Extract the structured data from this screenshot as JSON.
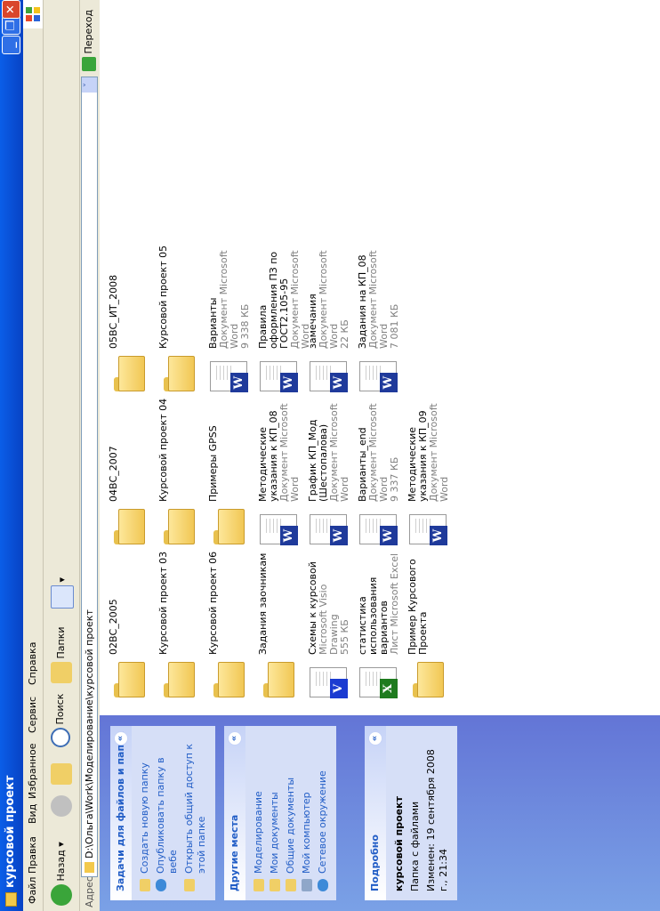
{
  "window": {
    "title": "курсовой проект"
  },
  "menu": [
    "Файл",
    "Правка",
    "Вид",
    "Избранное",
    "Сервис",
    "Справка"
  ],
  "toolbar": {
    "back": "Назад",
    "search": "Поиск",
    "folders": "Папки"
  },
  "address": {
    "label": "Адрес:",
    "path": "D:\\Ольга\\Work\\Моделирование\\курсовой проект",
    "go": "Переход"
  },
  "panels": {
    "tasks": {
      "title": "Задачи для файлов и папок",
      "links": [
        "Создать новую папку",
        "Опубликовать папку в вебе",
        "Открыть общий доступ к этой папке"
      ]
    },
    "places": {
      "title": "Другие места",
      "links": [
        "Моделирование",
        "Мои документы",
        "Общие документы",
        "Мой компьютер",
        "Сетевое окружение"
      ]
    },
    "details": {
      "title": "Подробно",
      "name": "курсовой проект",
      "type": "Папка с файлами",
      "modified": "Изменен: 19 сентября 2008 г., 21:34"
    }
  },
  "colors": {
    "word": "#1f3a9b",
    "visio": "#1b3bd1",
    "excel": "#1e7b1e"
  },
  "items": [
    {
      "name": "02ВС_2005",
      "icon": "folder-icon"
    },
    {
      "name": "04ВС_2007",
      "icon": "folder-icon"
    },
    {
      "name": "05ВС_ИТ_2008",
      "icon": "folder-icon"
    },
    {
      "name": "Курсовой проект 03",
      "icon": "folder-icon"
    },
    {
      "name": "Курсовой проект 04",
      "icon": "folder-icon"
    },
    {
      "name": "Курсовой проект 05",
      "icon": "folder-icon"
    },
    {
      "name": "Курсовой проект 06",
      "icon": "folder-icon"
    },
    {
      "name": "Примеры GPSS",
      "icon": "folder-icon"
    },
    {
      "name": "Варианты",
      "type": "Документ Microsoft Word",
      "size": "9 338 КБ",
      "icon": "word-icon"
    },
    {
      "name": "Задания заочникам",
      "icon": "folder-icon"
    },
    {
      "name": "Методические указания к КП_08",
      "type": "Документ Microsoft Word",
      "size": "",
      "icon": "word-icon"
    },
    {
      "name": "Правила оформления ПЗ по ГОСТ2.105-95",
      "type": "Документ Microsoft Word",
      "size": "",
      "icon": "word-icon"
    },
    {
      "name": "Схемы к курсовой",
      "type": "Microsoft Visio Drawing",
      "size": "555 КБ",
      "icon": "visio-icon"
    },
    {
      "name": "График КП_Мод (Шестопалова)",
      "type": "Документ Microsoft Word",
      "size": "",
      "icon": "word-icon"
    },
    {
      "name": "замечания",
      "type": "Документ Microsoft Word",
      "size": "22 КБ",
      "icon": "word-icon"
    },
    {
      "name": "статистика использования вариантов",
      "type": "Лист Microsoft Excel",
      "size": "",
      "icon": "excel-icon"
    },
    {
      "name": "Варианты_end",
      "type": "Документ Microsoft Word",
      "size": "9 337 КБ",
      "icon": "word-icon"
    },
    {
      "name": "Задания на КП_08",
      "type": "Документ Microsoft Word",
      "size": "7 081 КБ",
      "icon": "word-icon"
    },
    {
      "name": "Пример Курсового Проекта",
      "icon": "folder-icon"
    },
    {
      "name": "Методические указания к КП_09",
      "type": "Документ Microsoft Word",
      "size": "",
      "icon": "word-icon"
    }
  ]
}
